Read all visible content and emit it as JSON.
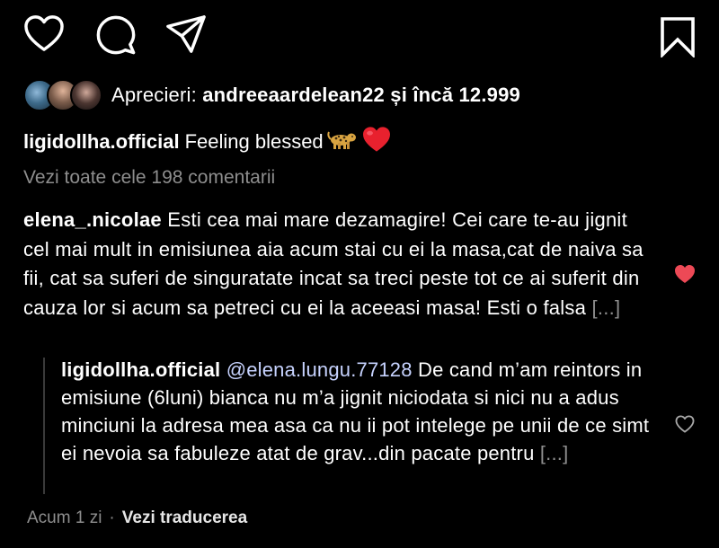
{
  "likes": {
    "prefix": "Aprecieri: ",
    "user": "andreeaardelean22",
    "suffix": " și încă 12.999"
  },
  "caption": {
    "username": "ligidollha.official",
    "text": "Feeling blessed"
  },
  "view_all_comments": "Vezi toate cele 198 comentarii",
  "comment": {
    "username": "elena_.nicolae",
    "text": "Esti cea mai mare dezamagire! Cei care te-au jignit cel mai mult in emisiunea aia acum stai cu ei la masa,cat de naiva sa fii, cat sa suferi de singuratate incat sa treci peste tot ce ai suferit din cauza lor si acum sa petreci cu ei la aceeasi masa! Esti o falsa",
    "more": "[...]",
    "liked": true
  },
  "reply": {
    "username": "ligidollha.official",
    "mention": "@elena.lungu.77128",
    "text": "De cand m’am reintors in emisiune (6luni) bianca nu m’a jignit niciodata si nici nu a adus minciuni la adresa mea asa ca nu ii pot intelege pe unii de ce simt ei nevoia sa fabuleze atat de grav...din pacate pentru",
    "more": "[...]",
    "liked": false
  },
  "footer": {
    "time": "Acum 1 zi",
    "separator": "·",
    "translate": "Vezi traducerea"
  },
  "icons": {
    "like": "heart-outline-icon",
    "comment": "speech-bubble-icon",
    "share": "paper-plane-icon",
    "save": "bookmark-icon",
    "comment_like": "heart-filled-icon",
    "reply_like": "heart-outline-icon"
  },
  "colors": {
    "background": "#000000",
    "text": "#ffffff",
    "secondary": "#8e8e8e",
    "like_red": "#ed4956",
    "mention": "#c7d3ff"
  }
}
